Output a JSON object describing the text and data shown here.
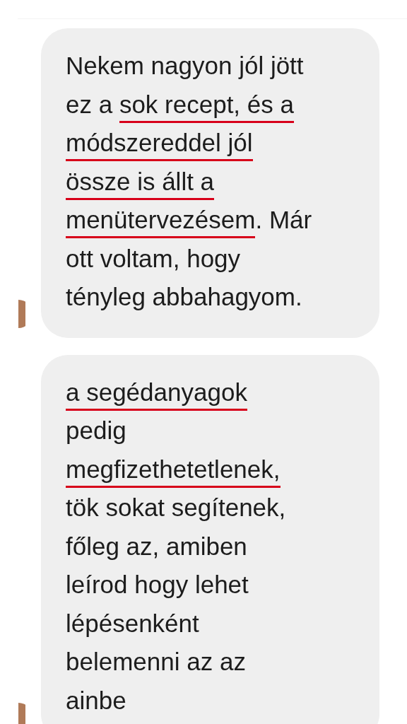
{
  "messages": [
    {
      "avatar_visible": true,
      "lines": [
        [
          {
            "text": "Nekem nagyon jól jött",
            "underlined": false
          }
        ],
        [
          {
            "text": "ez a ",
            "underlined": false
          },
          {
            "text": "sok recept, és a",
            "underlined": true
          }
        ],
        [
          {
            "text": "módszereddel jól",
            "underlined": true
          }
        ],
        [
          {
            "text": "össze is állt a",
            "underlined": true
          }
        ],
        [
          {
            "text": "menütervezésem",
            "underlined": true
          },
          {
            "text": ". Már",
            "underlined": false
          }
        ],
        [
          {
            "text": "ott voltam, hogy",
            "underlined": false
          }
        ],
        [
          {
            "text": "tényleg abbahagyom.",
            "underlined": false
          }
        ]
      ]
    },
    {
      "avatar_visible": true,
      "lines": [
        [
          {
            "text": "a segédanyagok",
            "underlined": true
          }
        ],
        [
          {
            "text": "pedig",
            "underlined": false
          }
        ],
        [
          {
            "text": "megfizethetetlenek,",
            "underlined": true
          }
        ],
        [
          {
            "text": "tök sokat segítenek,",
            "underlined": false
          }
        ],
        [
          {
            "text": "főleg az, amiben",
            "underlined": false
          }
        ],
        [
          {
            "text": "leírod hogy lehet",
            "underlined": false
          }
        ],
        [
          {
            "text": "lépésenként",
            "underlined": false
          }
        ],
        [
          {
            "text": "belemenni az az",
            "underlined": false
          }
        ],
        [
          {
            "text": "ainbe",
            "underlined": false
          }
        ]
      ]
    }
  ]
}
